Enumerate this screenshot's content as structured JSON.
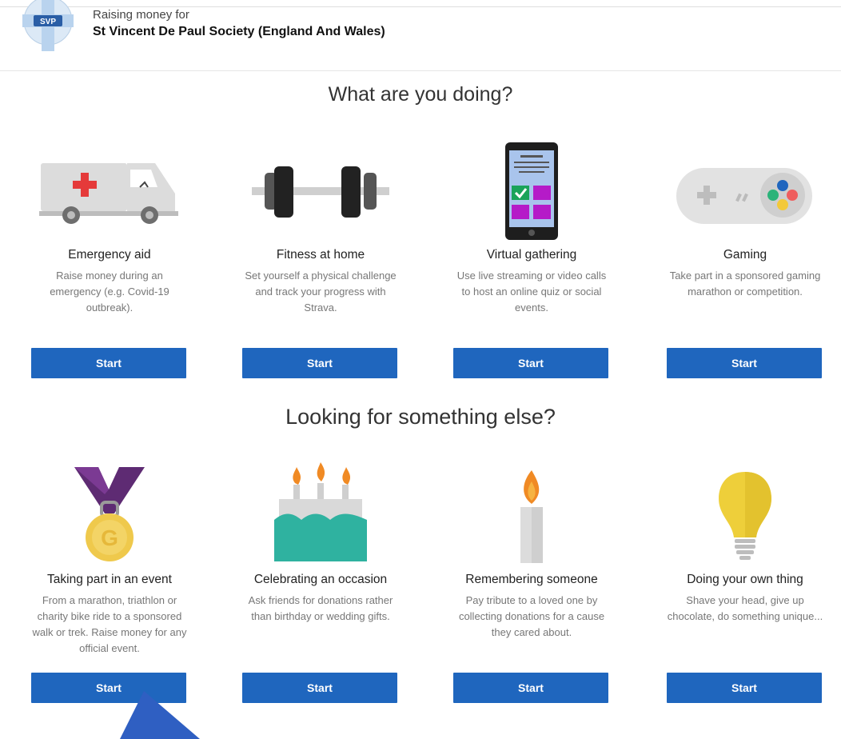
{
  "header": {
    "raising_label": "Raising money for",
    "charity_name": "St Vincent De Paul Society (England And Wales)",
    "logo_icon": "svp-logo-icon",
    "logo_text": "SVP"
  },
  "section1": {
    "title": "What are you doing?",
    "cards": [
      {
        "name": "Emergency aid",
        "desc": "Raise money during an emergency (e.g. Covid-19 outbreak).",
        "button": "Start",
        "icon": "ambulance-icon"
      },
      {
        "name": "Fitness at home",
        "desc": "Set yourself a physical challenge and track your progress with Strava.",
        "button": "Start",
        "icon": "dumbbell-icon"
      },
      {
        "name": "Virtual gathering",
        "desc": "Use live streaming or video calls to host an online quiz or social events.",
        "button": "Start",
        "icon": "smartphone-icon"
      },
      {
        "name": "Gaming",
        "desc": "Take part in a sponsored gaming marathon or competition.",
        "button": "Start",
        "icon": "game-controller-icon"
      }
    ]
  },
  "section2": {
    "title": "Looking for something else?",
    "cards": [
      {
        "name": "Taking part in an event",
        "desc": "From a marathon, triathlon or charity bike ride to a sponsored walk or trek. Raise money for any official event.",
        "button": "Start",
        "icon": "medal-icon"
      },
      {
        "name": "Celebrating an occasion",
        "desc": "Ask friends for donations rather than birthday or wedding gifts.",
        "button": "Start",
        "icon": "birthday-cake-icon"
      },
      {
        "name": "Remembering someone",
        "desc": "Pay tribute to a loved one by collecting donations for a cause they cared about.",
        "button": "Start",
        "icon": "candle-icon"
      },
      {
        "name": "Doing your own thing",
        "desc": "Shave your head, give up chocolate, do something unique...",
        "button": "Start",
        "icon": "light-bulb-icon"
      }
    ]
  },
  "colors": {
    "button_blue": "#1f66be",
    "cursor_arrow": "#2f5fc2"
  }
}
